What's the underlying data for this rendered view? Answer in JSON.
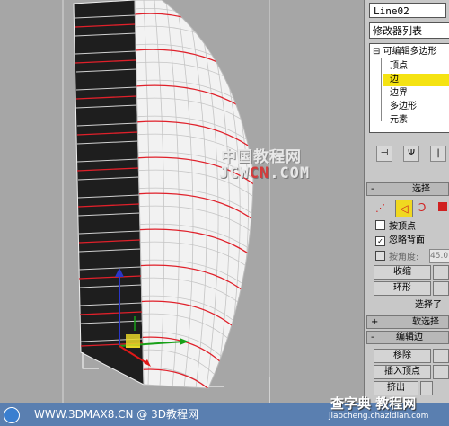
{
  "object_name": "Line02",
  "modifier_list_label": "修改器列表",
  "modifier_stack": [
    {
      "label": "可编辑多边形",
      "prefix": "⊟"
    },
    {
      "label": "顶点"
    },
    {
      "label": "边",
      "selected": true
    },
    {
      "label": "边界"
    },
    {
      "label": "多边形"
    },
    {
      "label": "元素"
    }
  ],
  "selection_rollout": {
    "sign": "-",
    "title": "选择",
    "by_vertex_label": "按顶点",
    "by_vertex_checked": false,
    "ignore_backfacing_label": "忽略背面",
    "ignore_backfacing_checked": true,
    "by_angle_label": "按角度:",
    "by_angle_value": "45.0",
    "shrink_label": "收缩",
    "ring_label": "环形",
    "selected_count_label": "选择了"
  },
  "soft_selection_rollout": {
    "sign": "+",
    "title": "软选择"
  },
  "edit_edges_rollout": {
    "sign": "-",
    "title": "编辑边",
    "remove_label": "移除",
    "insert_vertex_label": "插入顶点",
    "extrude_label": "挤出"
  },
  "watermark": {
    "main": "中国教程网",
    "url_part1": "JCW",
    "url_part2": "CN",
    "url_part3": ".COM"
  },
  "footer": {
    "text": "WWW.3DMAX8.CN @ 3D教程网"
  },
  "site_mark": {
    "name": "查字典 教程网",
    "url": "jiaocheng.chazidian.com"
  },
  "colors": {
    "selected_item": "#f5e312",
    "edge_red": "#e0202a",
    "footer_bg": "#5a7fb0"
  }
}
